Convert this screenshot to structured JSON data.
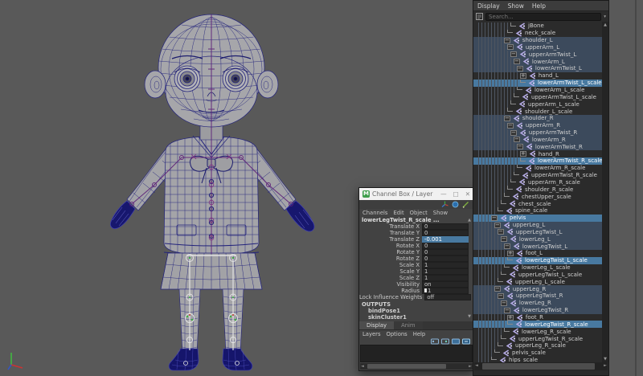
{
  "colors": {
    "viewport_bg": "#595959",
    "selection_blue": "#4879a0",
    "hierarchy_tint": "#3c4a5c",
    "wireframe_navy": "#23237c",
    "joint_icon_purple": "#b5abe6"
  },
  "glyphs": {
    "expanded": "−",
    "collapsed": "+",
    "scroll_up": "▲",
    "scroll_down": "▼",
    "scroll_left": "◄",
    "scroll_right": "►",
    "dropdown": "▾",
    "minimize": "—",
    "maximize": "□",
    "close": "✕"
  },
  "channel_box": {
    "title": "Channel Box / Layer Edi...",
    "logo_letter": "M",
    "menus": [
      "Channels",
      "Edit",
      "Object",
      "Show"
    ],
    "object_name": "lowerLegTwist_R_scale ...",
    "channels": [
      {
        "label": "Translate X",
        "value": "0",
        "selected": false,
        "slider": false
      },
      {
        "label": "Translate Y",
        "value": "0",
        "selected": false,
        "slider": false
      },
      {
        "label": "Translate Z",
        "value": "-0.001",
        "selected": true,
        "slider": false
      },
      {
        "label": "Rotate X",
        "value": "0",
        "selected": false,
        "slider": false
      },
      {
        "label": "Rotate Y",
        "value": "0",
        "selected": false,
        "slider": false
      },
      {
        "label": "Rotate Z",
        "value": "0",
        "selected": false,
        "slider": false
      },
      {
        "label": "Scale X",
        "value": "1",
        "selected": false,
        "slider": false
      },
      {
        "label": "Scale Y",
        "value": "1",
        "selected": false,
        "slider": false
      },
      {
        "label": "Scale Z",
        "value": "1",
        "selected": false,
        "slider": false
      },
      {
        "label": "Visibility",
        "value": "on",
        "selected": false,
        "slider": false
      },
      {
        "label": "Radius",
        "value": "1",
        "selected": false,
        "slider": true
      },
      {
        "label": "Lock Influence Weights",
        "value": "off",
        "selected": false,
        "slider": false
      }
    ],
    "outputs_header": "OUTPUTS",
    "outputs": [
      "bindPose1",
      "skinCluster1"
    ],
    "layer_tabs": [
      "Display",
      "Anim"
    ],
    "layer_menus": [
      "Layers",
      "Options",
      "Help"
    ]
  },
  "outliner": {
    "menus": [
      "Display",
      "Show",
      "Help"
    ],
    "search_placeholder": "Search...",
    "tree": [
      {
        "label": "jBone",
        "depth": 10,
        "state": "leaf",
        "highlight": "none"
      },
      {
        "label": "neck_scale",
        "depth": 9,
        "state": "leaf",
        "highlight": "none"
      },
      {
        "label": "shoulder_L",
        "depth": 8,
        "state": "expanded",
        "highlight": "block"
      },
      {
        "label": "upperArm_L",
        "depth": 9,
        "state": "expanded",
        "highlight": "block"
      },
      {
        "label": "upperArmTwist_L",
        "depth": 10,
        "state": "expanded",
        "highlight": "block"
      },
      {
        "label": "lowerArm_L",
        "depth": 11,
        "state": "expanded",
        "highlight": "block"
      },
      {
        "label": "lowerArmTwist_L",
        "depth": 12,
        "state": "expanded",
        "highlight": "block"
      },
      {
        "label": "hand_L",
        "depth": 13,
        "state": "collapsed",
        "highlight": "none"
      },
      {
        "label": "lowerArmTwist_L_scale",
        "depth": 13,
        "state": "leaf",
        "highlight": "selected"
      },
      {
        "label": "lowerArm_L_scale",
        "depth": 12,
        "state": "leaf",
        "highlight": "none"
      },
      {
        "label": "upperArmTwist_L_scale",
        "depth": 11,
        "state": "leaf",
        "highlight": "none"
      },
      {
        "label": "upperArm_L_scale",
        "depth": 10,
        "state": "leaf",
        "highlight": "none"
      },
      {
        "label": "shoulder_L_scale",
        "depth": 9,
        "state": "leaf",
        "highlight": "none"
      },
      {
        "label": "shoulder_R",
        "depth": 8,
        "state": "expanded",
        "highlight": "block"
      },
      {
        "label": "upperArm_R",
        "depth": 9,
        "state": "expanded",
        "highlight": "block"
      },
      {
        "label": "upperArmTwist_R",
        "depth": 10,
        "state": "expanded",
        "highlight": "block"
      },
      {
        "label": "lowerArm_R",
        "depth": 11,
        "state": "expanded",
        "highlight": "block"
      },
      {
        "label": "lowerArmTwist_R",
        "depth": 12,
        "state": "expanded",
        "highlight": "block"
      },
      {
        "label": "hand_R",
        "depth": 13,
        "state": "collapsed",
        "highlight": "none"
      },
      {
        "label": "lowerArmTwist_R_scale",
        "depth": 13,
        "state": "leaf",
        "highlight": "selected"
      },
      {
        "label": "lowerArm_R_scale",
        "depth": 12,
        "state": "leaf",
        "highlight": "none"
      },
      {
        "label": "upperArmTwist_R_scale",
        "depth": 11,
        "state": "leaf",
        "highlight": "none"
      },
      {
        "label": "upperArm_R_scale",
        "depth": 10,
        "state": "leaf",
        "highlight": "none"
      },
      {
        "label": "shoulder_R_scale",
        "depth": 9,
        "state": "leaf",
        "highlight": "none"
      },
      {
        "label": "chestUpper_scale",
        "depth": 8,
        "state": "leaf",
        "highlight": "none"
      },
      {
        "label": "chest_scale",
        "depth": 7,
        "state": "leaf",
        "highlight": "none"
      },
      {
        "label": "spine_scale",
        "depth": 6,
        "state": "leaf",
        "highlight": "none"
      },
      {
        "label": "pelvis",
        "depth": 4,
        "state": "expanded",
        "highlight": "selected"
      },
      {
        "label": "upperLeg_L",
        "depth": 5,
        "state": "expanded",
        "highlight": "block"
      },
      {
        "label": "upperLegTwist_L",
        "depth": 6,
        "state": "expanded",
        "highlight": "block"
      },
      {
        "label": "lowerLeg_L",
        "depth": 7,
        "state": "expanded",
        "highlight": "block"
      },
      {
        "label": "lowerLegTwist_L",
        "depth": 8,
        "state": "expanded",
        "highlight": "block"
      },
      {
        "label": "foot_L",
        "depth": 9,
        "state": "collapsed",
        "highlight": "none"
      },
      {
        "label": "lowerLegTwist_L_scale",
        "depth": 9,
        "state": "leaf",
        "highlight": "selected"
      },
      {
        "label": "lowerLeg_L_scale",
        "depth": 8,
        "state": "leaf",
        "highlight": "none"
      },
      {
        "label": "upperLegTwist_L_scale",
        "depth": 7,
        "state": "leaf",
        "highlight": "none"
      },
      {
        "label": "upperLeg_L_scale",
        "depth": 6,
        "state": "leaf",
        "highlight": "none"
      },
      {
        "label": "upperLeg_R",
        "depth": 5,
        "state": "expanded",
        "highlight": "block"
      },
      {
        "label": "upperLegTwist_R",
        "depth": 6,
        "state": "expanded",
        "highlight": "block"
      },
      {
        "label": "lowerLeg_R",
        "depth": 7,
        "state": "expanded",
        "highlight": "block"
      },
      {
        "label": "lowerLegTwist_R",
        "depth": 8,
        "state": "expanded",
        "highlight": "block"
      },
      {
        "label": "foot_R",
        "depth": 9,
        "state": "collapsed",
        "highlight": "none"
      },
      {
        "label": "lowerLegTwist_R_scale",
        "depth": 9,
        "state": "leaf",
        "highlight": "selected"
      },
      {
        "label": "lowerLeg_R_scale",
        "depth": 8,
        "state": "leaf",
        "highlight": "none"
      },
      {
        "label": "upperLegTwist_R_scale",
        "depth": 7,
        "state": "leaf",
        "highlight": "none"
      },
      {
        "label": "upperLeg_R_scale",
        "depth": 6,
        "state": "leaf",
        "highlight": "none"
      },
      {
        "label": "pelvis_scale",
        "depth": 5,
        "state": "leaf",
        "highlight": "none"
      },
      {
        "label": "hips_scale",
        "depth": 4,
        "state": "leaf",
        "highlight": "none"
      }
    ]
  },
  "icons": {
    "maya_logo": "maya-logo-icon",
    "filter": "filter-icon",
    "joint": "joint-icon",
    "axis_gizmo": "axis-gizmo",
    "manipulator": "manipulator-icon",
    "rotate_tool": "rotate-manipulator-icon",
    "pencil": "pencil-icon",
    "layer_buttons": [
      "layers-mode-icon",
      "create-empty-layer-icon",
      "new-layer-from-selected-icon",
      "new-override-layer-icon"
    ]
  }
}
